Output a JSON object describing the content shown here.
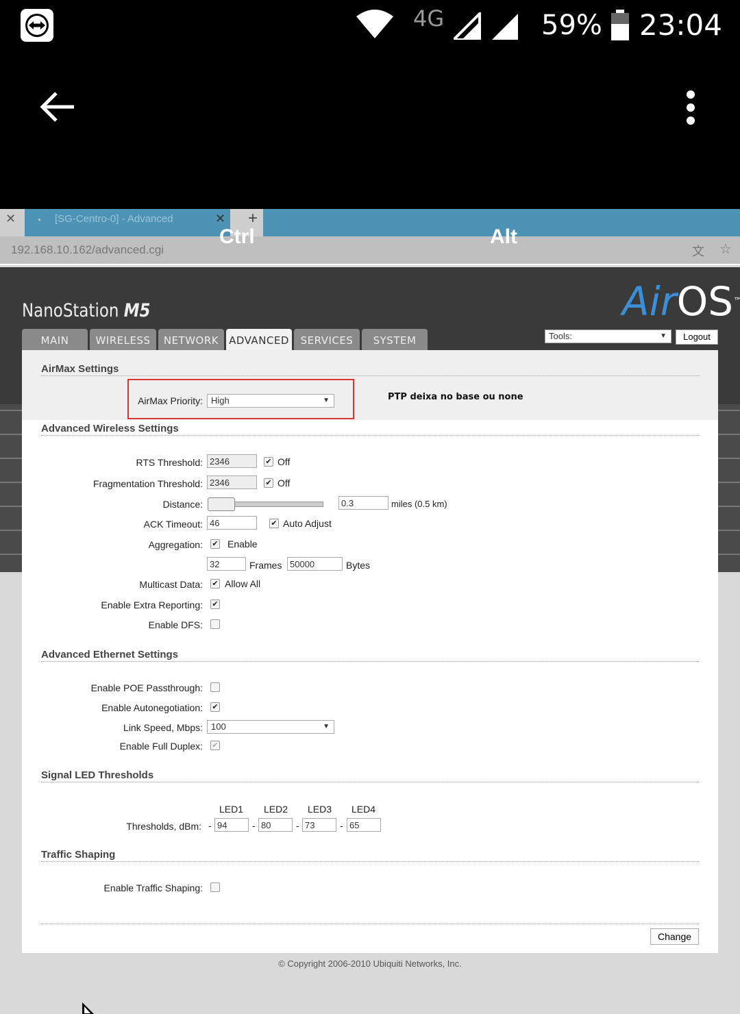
{
  "status_bar": {
    "network": "4G",
    "battery": "59%",
    "time": "23:04",
    "icons": [
      "teamviewer-icon",
      "wifi-icon",
      "signal-icon",
      "battery-icon"
    ]
  },
  "app_bar": {
    "back_icon": "arrow-left-icon",
    "menu_icon": "more-vert-icon"
  },
  "browser": {
    "tab_title": "[SG-Centro-0] - Advanced",
    "url": "192.168.10.162/advanced.cgi",
    "overlay_ctrl": "Ctrl",
    "overlay_alt": "Alt"
  },
  "header": {
    "device": "NanoStation",
    "model": "M5",
    "logo_air": "Air",
    "logo_os": "OS",
    "logo_tm": "™",
    "tools_label": "Tools:",
    "logout": "Logout"
  },
  "tabs": [
    {
      "label": "MAIN"
    },
    {
      "label": "WIRELESS"
    },
    {
      "label": "NETWORK"
    },
    {
      "label": "ADVANCED",
      "active": true
    },
    {
      "label": "SERVICES"
    },
    {
      "label": "SYSTEM"
    }
  ],
  "airmax": {
    "title": "AirMax Settings",
    "priority_label": "AirMax Priority:",
    "priority_value": "High",
    "note": "PTP deixa no base ou none"
  },
  "wireless": {
    "title": "Advanced Wireless Settings",
    "rts_label": "RTS Threshold:",
    "rts_value": "2346",
    "rts_off": "Off",
    "frag_label": "Fragmentation Threshold:",
    "frag_value": "2346",
    "frag_off": "Off",
    "distance_label": "Distance:",
    "distance_value": "0.3",
    "distance_unit": "miles (0.5 km)",
    "ack_label": "ACK Timeout:",
    "ack_value": "46",
    "ack_auto": "Auto Adjust",
    "aggregation_label": "Aggregation:",
    "aggregation_enable": "Enable",
    "frames_value": "32",
    "frames_label": "Frames",
    "bytes_value": "50000",
    "bytes_label": "Bytes",
    "multicast_label": "Multicast Data:",
    "multicast_allow": "Allow All",
    "extra_label": "Enable Extra Reporting:",
    "dfs_label": "Enable DFS:"
  },
  "ethernet": {
    "title": "Advanced Ethernet Settings",
    "poe_label": "Enable POE Passthrough:",
    "autoneg_label": "Enable Autonegotiation:",
    "speed_label": "Link Speed, Mbps:",
    "speed_value": "100",
    "duplex_label": "Enable Full Duplex:"
  },
  "led": {
    "title": "Signal LED Thresholds",
    "headers": [
      "LED1",
      "LED2",
      "LED3",
      "LED4"
    ],
    "label": "Thresholds, dBm:",
    "minus": "-",
    "values": [
      "94",
      "80",
      "73",
      "65"
    ]
  },
  "traffic": {
    "title": "Traffic Shaping",
    "enable_label": "Enable Traffic Shaping:"
  },
  "footer": {
    "change": "Change",
    "copyright": "© Copyright 2006-2010 Ubiquiti Networks, Inc."
  }
}
